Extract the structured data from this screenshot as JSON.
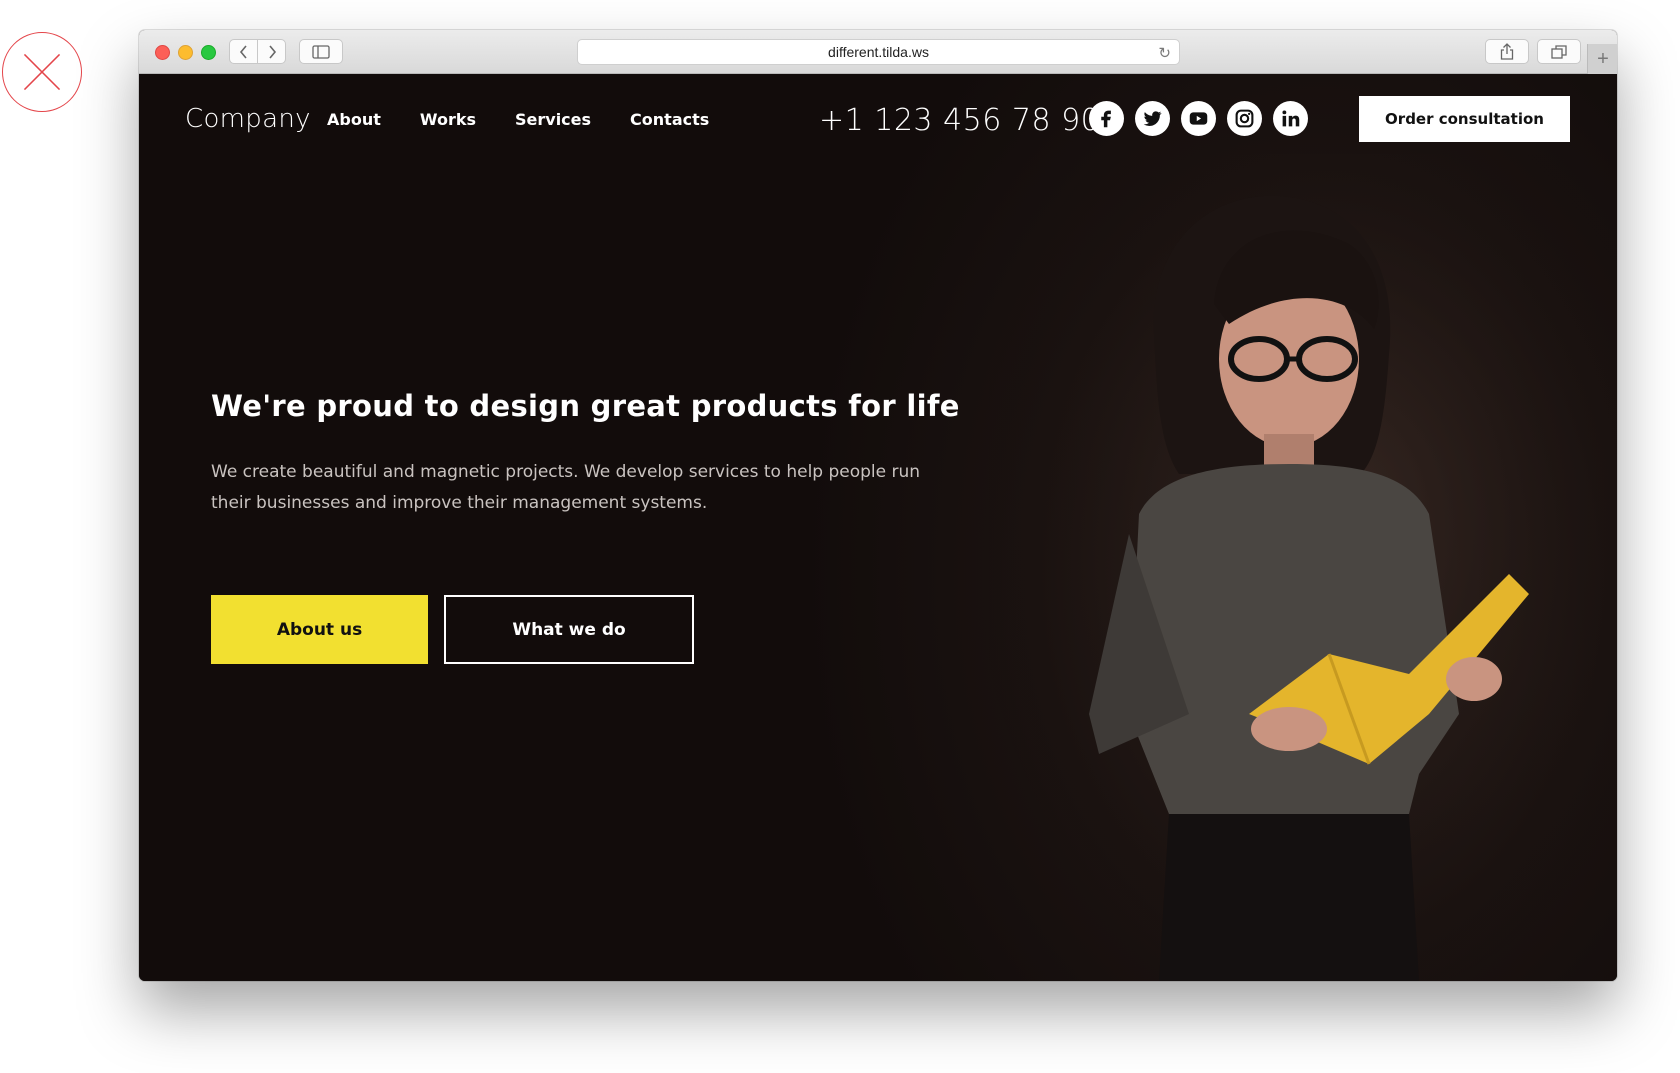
{
  "browser": {
    "url": "different.tilda.ws"
  },
  "site": {
    "logo": "Company",
    "menu": [
      "About",
      "Works",
      "Services",
      "Contacts"
    ],
    "phone": "+1 123 456 78 90",
    "socials": [
      "facebook-icon",
      "twitter-icon",
      "youtube-icon",
      "instagram-icon",
      "linkedin-icon"
    ],
    "order_button": "Order consultation"
  },
  "hero": {
    "title": "We're proud to design great products for life",
    "text": "We create beautiful and magnetic projects. We develop services to help people run their businesses and improve their management systems.",
    "primary_button": "About us",
    "secondary_button": "What we do"
  },
  "colors": {
    "accent_yellow": "#f2e030",
    "background_dark": "#120c0b",
    "close_mark": "#e4454a"
  }
}
